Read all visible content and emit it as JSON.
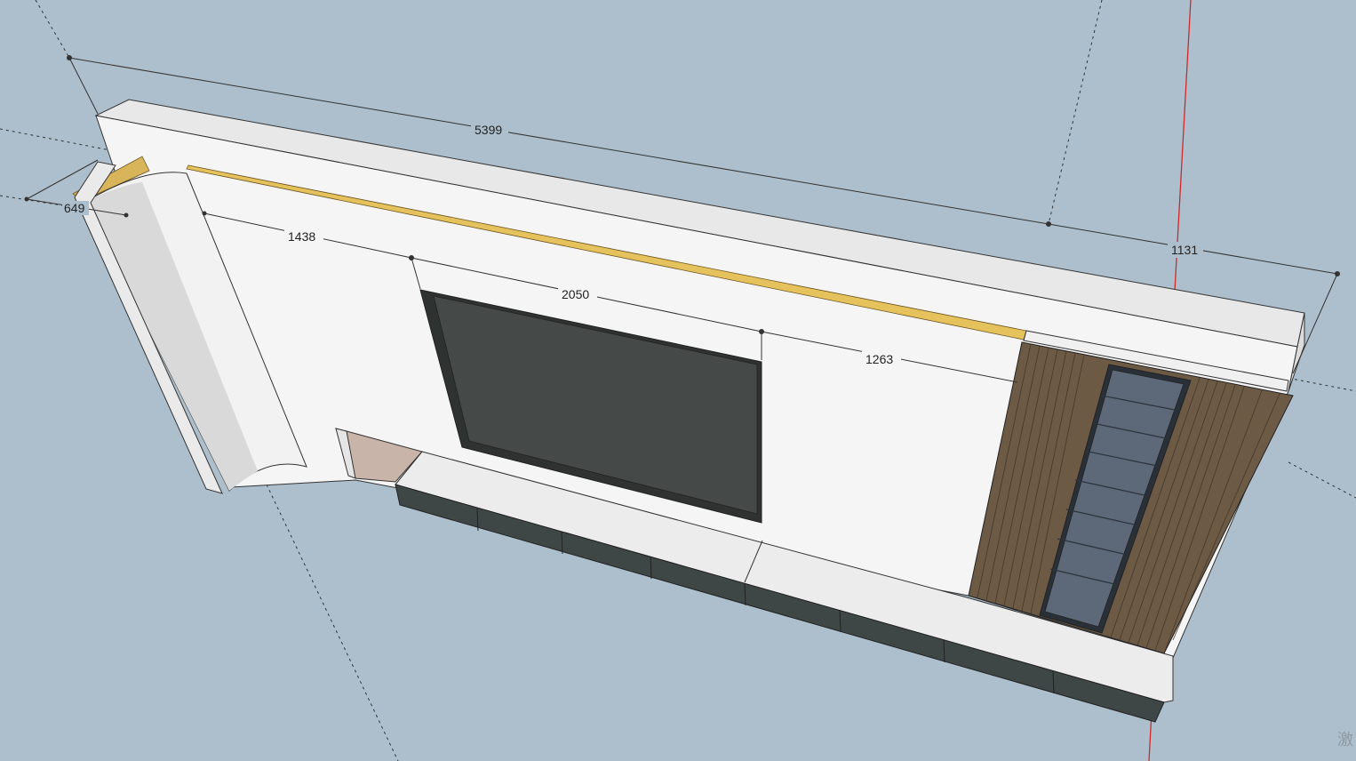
{
  "app": {
    "view": "3D model viewport"
  },
  "colors": {
    "background": "#adbfcc",
    "wall": "#f4f4f4",
    "top_edge": "#e7e7e7",
    "gold_strip": "#e6c25d",
    "tv_screen": "#454a48",
    "cabinet_dark": "#3f4746",
    "wood_slats": "#6d5a45",
    "shelf_unit": "#5d6878",
    "axis_red": "#cc2a2a",
    "door_opening": "#c8b4a8"
  },
  "dimensions": {
    "total_width": "5399",
    "side_depth": "649",
    "left_offset": "1438",
    "tv_width": "2050",
    "right_offset": "1263",
    "cabinet_width": "1131"
  },
  "watermark": "激"
}
